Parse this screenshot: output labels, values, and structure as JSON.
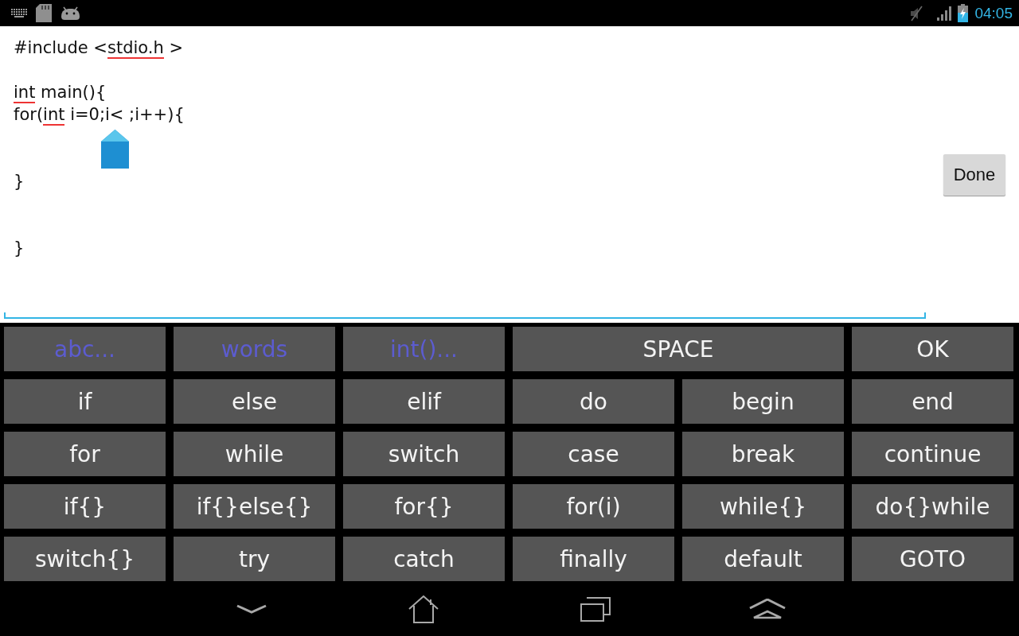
{
  "status_bar": {
    "time": "04:05"
  },
  "editor": {
    "lines": [
      {
        "kind": "code",
        "segments": [
          {
            "text": "#include <",
            "misspelled": false
          },
          {
            "text": "stdio.h",
            "misspelled": true
          },
          {
            "text": " >",
            "misspelled": false
          }
        ]
      },
      {
        "kind": "blank"
      },
      {
        "kind": "code",
        "segments": [
          {
            "text": "int",
            "misspelled": true
          },
          {
            "text": " main(){",
            "misspelled": false
          }
        ]
      },
      {
        "kind": "code",
        "segments": [
          {
            "text": "for(",
            "misspelled": false
          },
          {
            "text": "int",
            "misspelled": true
          },
          {
            "text": " i=0;i< ;i++){",
            "misspelled": false
          }
        ]
      },
      {
        "kind": "blank"
      },
      {
        "kind": "blank"
      },
      {
        "kind": "code",
        "segments": [
          {
            "text": "}",
            "misspelled": false
          }
        ]
      },
      {
        "kind": "blank"
      },
      {
        "kind": "blank"
      },
      {
        "kind": "code",
        "segments": [
          {
            "text": "}",
            "misspelled": false
          }
        ]
      }
    ],
    "done_button": "Done"
  },
  "keyboard": {
    "keys": [
      {
        "label": "abc...",
        "kind": "mode"
      },
      {
        "label": "words",
        "kind": "mode"
      },
      {
        "label": "int()...",
        "kind": "mode"
      },
      {
        "label": "SPACE",
        "kind": "wide"
      },
      {
        "label": "OK",
        "kind": "key"
      },
      {
        "label": "if",
        "kind": "key"
      },
      {
        "label": "else",
        "kind": "key"
      },
      {
        "label": "elif",
        "kind": "key"
      },
      {
        "label": "do",
        "kind": "key"
      },
      {
        "label": "begin",
        "kind": "key"
      },
      {
        "label": "end",
        "kind": "key"
      },
      {
        "label": "for",
        "kind": "key"
      },
      {
        "label": "while",
        "kind": "key"
      },
      {
        "label": "switch",
        "kind": "key"
      },
      {
        "label": "case",
        "kind": "key"
      },
      {
        "label": "break",
        "kind": "key"
      },
      {
        "label": "continue",
        "kind": "key"
      },
      {
        "label": "if{}",
        "kind": "key"
      },
      {
        "label": "if{}else{}",
        "kind": "key"
      },
      {
        "label": "for{}",
        "kind": "key"
      },
      {
        "label": "for(i)",
        "kind": "key"
      },
      {
        "label": "while{}",
        "kind": "key"
      },
      {
        "label": "do{}while",
        "kind": "key"
      },
      {
        "label": "switch{}",
        "kind": "key"
      },
      {
        "label": "try",
        "kind": "key"
      },
      {
        "label": "catch",
        "kind": "key"
      },
      {
        "label": "finally",
        "kind": "key"
      },
      {
        "label": "default",
        "kind": "key"
      },
      {
        "label": "GOTO",
        "kind": "key"
      }
    ]
  }
}
